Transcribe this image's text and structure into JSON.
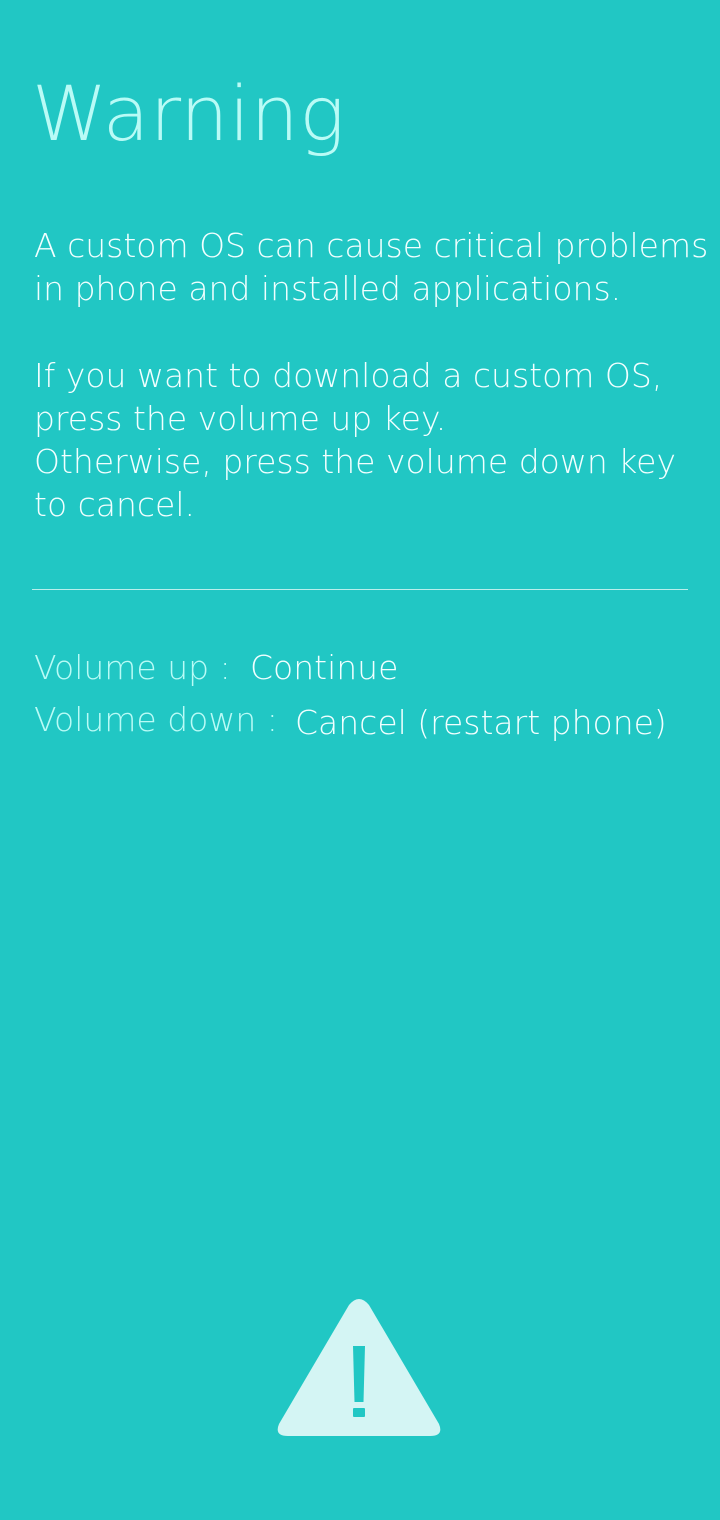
{
  "warning": {
    "title": "Warning",
    "paragraph1": [
      "A custom OS can cause critical problems",
      "in phone and installed applications."
    ],
    "paragraph2": [
      "If you want to download a custom OS,",
      "press the volume up key.",
      "Otherwise, press the volume down key",
      "to cancel."
    ]
  },
  "options": {
    "volume_up_key": "Volume up :",
    "volume_up_action": "Continue",
    "volume_down_key": "Volume down :",
    "volume_down_action": "Cancel (restart phone)"
  },
  "icon": "warning-triangle-icon",
  "colors": {
    "background": "#21c7c4",
    "title": "#b9fbf6",
    "body_text": "#f1ffff",
    "icon_fill": "#d4f5f4"
  }
}
